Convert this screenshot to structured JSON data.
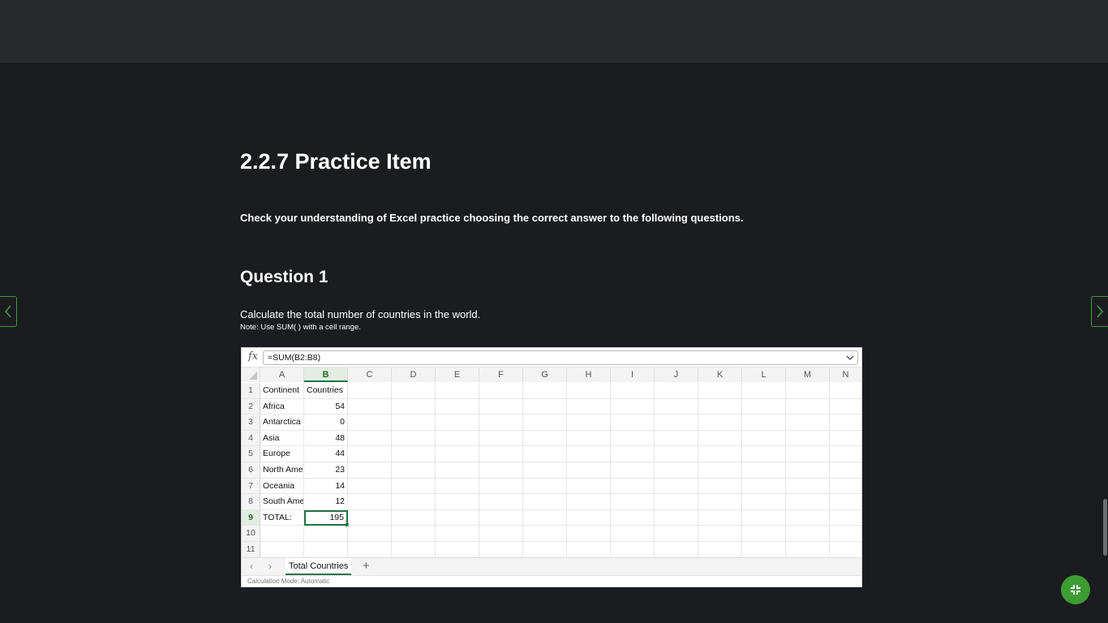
{
  "page": {
    "title": "2.2.7 Practice Item",
    "intro": "Check your understanding of Excel practice choosing the correct answer to the following questions."
  },
  "question": {
    "heading": "Question 1",
    "text": "Calculate the total number of countries in the world.",
    "note": "Note: Use SUM( ) with a cell range."
  },
  "spreadsheet": {
    "fx_label": "fx",
    "formula": "=SUM(B2:B8)",
    "columns": [
      "A",
      "B",
      "C",
      "D",
      "E",
      "F",
      "G",
      "H",
      "I",
      "J",
      "K",
      "L",
      "M",
      "N"
    ],
    "row_numbers": [
      "1",
      "2",
      "3",
      "4",
      "5",
      "6",
      "7",
      "8",
      "9",
      "10",
      "11"
    ],
    "rows": [
      {
        "a": "Continent",
        "b": "Countries"
      },
      {
        "a": "Africa",
        "b": "54"
      },
      {
        "a": "Antarctica",
        "b": "0"
      },
      {
        "a": "Asia",
        "b": "48"
      },
      {
        "a": "Europe",
        "b": "44"
      },
      {
        "a": "North Ame",
        "b": "23"
      },
      {
        "a": "Oceania",
        "b": "14"
      },
      {
        "a": "South Ame",
        "b": "12"
      },
      {
        "a": "TOTAL:",
        "b": "195"
      },
      {
        "a": "",
        "b": ""
      },
      {
        "a": "",
        "b": ""
      }
    ],
    "selected_column": "B",
    "selected_row": "9",
    "sheet_tab": "Total Countries",
    "tab_prev": "‹",
    "tab_next": "›",
    "tab_add": "+",
    "status": "Calculation Mode: Automatic"
  },
  "colors": {
    "background": "#1b1c20",
    "topbar": "#28292c",
    "accent_green": "#3d9c32",
    "excel_green": "#217346"
  },
  "icons": {
    "prev_page": "chevron-left-icon",
    "next_page": "chevron-right-icon",
    "fab": "collapse-icon",
    "formula_dropdown": "chevron-down-icon"
  }
}
